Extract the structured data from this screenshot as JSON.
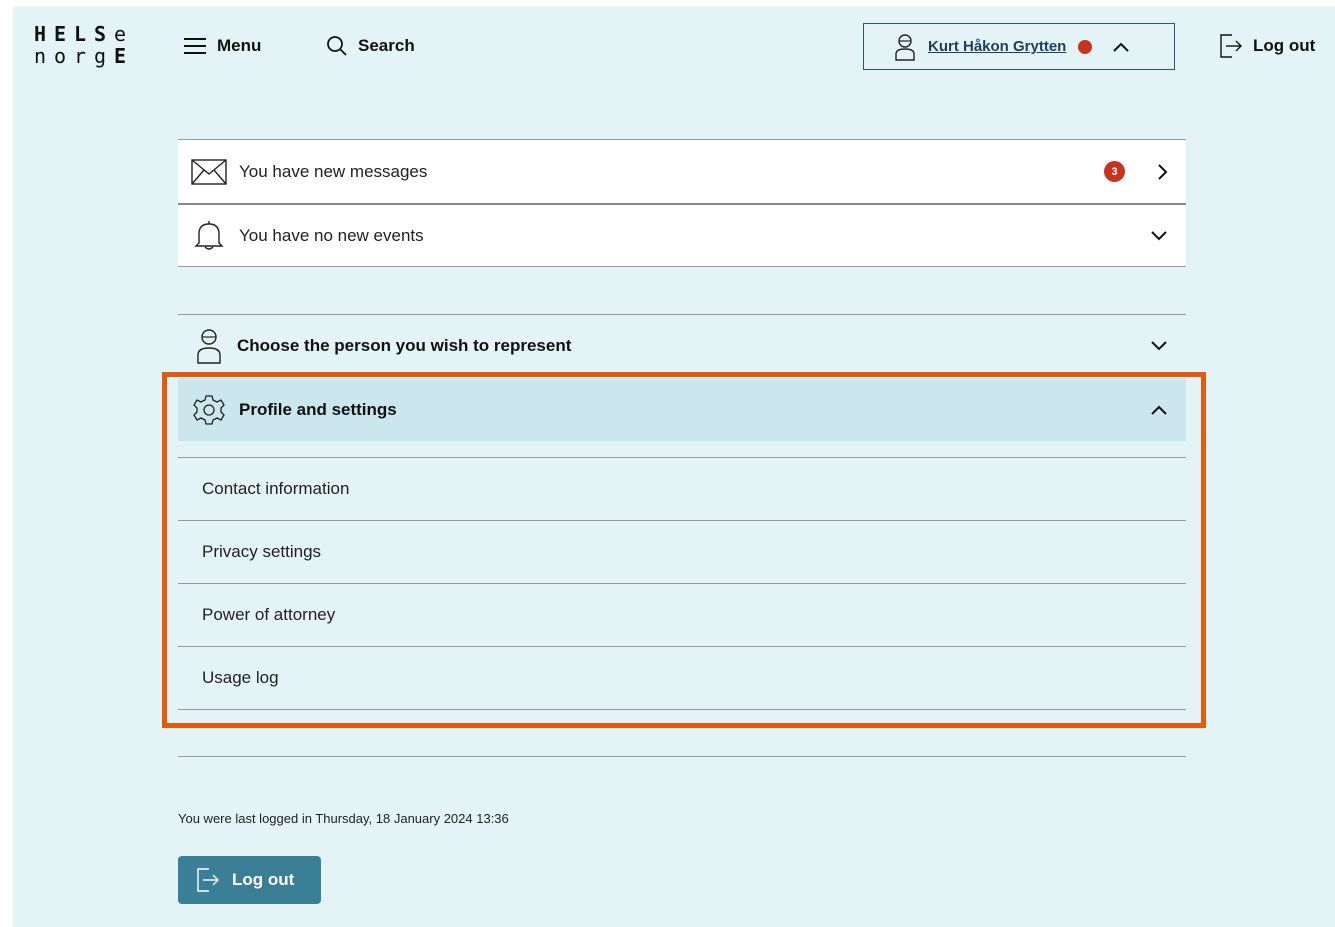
{
  "logo": {
    "row1": [
      "H",
      "E",
      "L",
      "S",
      "e"
    ],
    "row2": [
      "n",
      "o",
      "r",
      "g",
      "E"
    ]
  },
  "header": {
    "menu_label": "Menu",
    "search_label": "Search",
    "user_name": "Kurt Håkon Grytten",
    "logout_label": "Log out"
  },
  "notifications": {
    "messages_label": "You have new messages",
    "messages_count": "3",
    "events_label": "You have no new events"
  },
  "represent": {
    "label": "Choose the person you wish to represent"
  },
  "profile": {
    "label": "Profile and settings",
    "items": [
      {
        "label": "Contact information"
      },
      {
        "label": "Privacy settings"
      },
      {
        "label": "Power of attorney"
      },
      {
        "label": "Usage log"
      }
    ]
  },
  "footer": {
    "last_login": "You were last logged in Thursday, 18 January 2024 13:36",
    "logout_label": "Log out"
  },
  "colors": {
    "page_bg": "#e4f4f6",
    "accent": "#3a7f96",
    "badge": "#c8331f",
    "highlight": "#e35a0e",
    "selected_row": "#cbe6ec"
  }
}
